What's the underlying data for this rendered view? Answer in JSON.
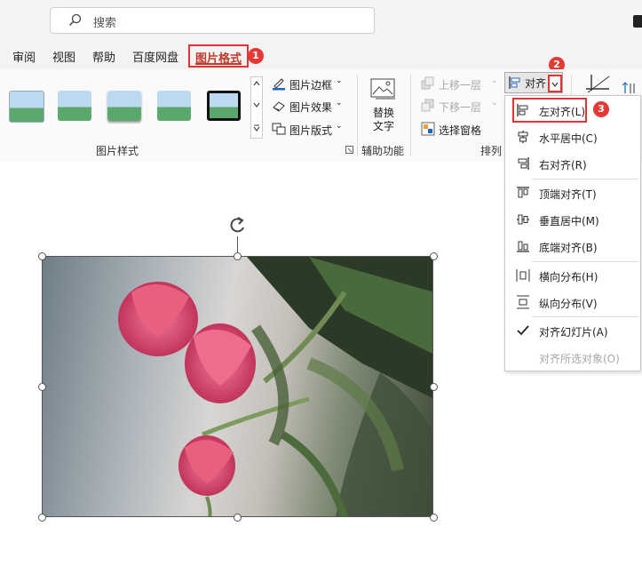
{
  "search": {
    "placeholder": "搜索"
  },
  "tabs": [
    {
      "label": "审阅"
    },
    {
      "label": "视图"
    },
    {
      "label": "帮助"
    },
    {
      "label": "百度网盘"
    },
    {
      "label": "图片格式",
      "active": true
    }
  ],
  "badges": {
    "one": "1",
    "two": "2",
    "three": "3"
  },
  "ribbon": {
    "picture_styles": {
      "label": "图片样式",
      "border": "图片边框",
      "effects": "图片效果",
      "layout": "图片版式"
    },
    "accessibility": {
      "label": "辅助功能",
      "alt_text_line1": "替换",
      "alt_text_line2": "文字"
    },
    "arrange": {
      "label": "排列",
      "bring_forward": "上移一层",
      "send_backward": "下移一层",
      "selection_pane": "选择窗格",
      "align": "对齐"
    }
  },
  "align_menu": {
    "items": [
      {
        "label": "左对齐(L)",
        "icon": "align-left-icon"
      },
      {
        "label": "水平居中(C)",
        "icon": "align-center-icon"
      },
      {
        "label": "右对齐(R)",
        "icon": "align-right-icon"
      },
      {
        "label": "顶端对齐(T)",
        "icon": "align-top-icon"
      },
      {
        "label": "垂直居中(M)",
        "icon": "align-middle-icon"
      },
      {
        "label": "底端对齐(B)",
        "icon": "align-bottom-icon"
      },
      {
        "label": "横向分布(H)",
        "icon": "distribute-horizontal-icon"
      },
      {
        "label": "纵向分布(V)",
        "icon": "distribute-vertical-icon"
      },
      {
        "label": "对齐幻灯片(A)",
        "icon": "checkmark-icon",
        "checked": true
      },
      {
        "label": "对齐所选对象(O)",
        "icon": "",
        "disabled": true
      }
    ]
  },
  "colors": {
    "accent_red": "#e03333",
    "tab_active": "#c0392b"
  }
}
